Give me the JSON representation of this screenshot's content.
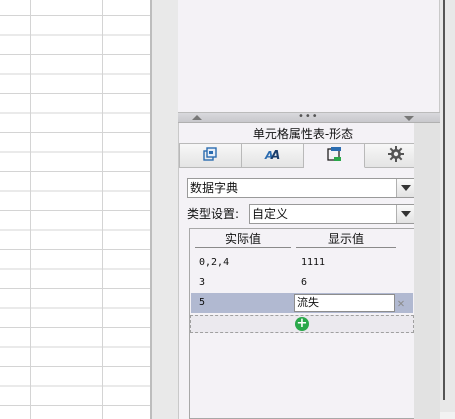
{
  "panel": {
    "title": "单元格属性表-形态"
  },
  "tabs": [
    {
      "icon": "cell-format-icon",
      "active": false
    },
    {
      "icon": "font-style-icon",
      "active": false
    },
    {
      "icon": "cell-element-icon",
      "active": true
    },
    {
      "icon": "gear-icon",
      "active": false
    }
  ],
  "form": {
    "dict_combo_value": "数据字典",
    "type_label": "类型设置:",
    "type_combo_value": "自定义"
  },
  "dict_table": {
    "headers": {
      "actual": "实际值",
      "display": "显示值"
    },
    "rows": [
      {
        "actual": "0,2,4",
        "display": "1111"
      },
      {
        "actual": "3",
        "display": "6"
      },
      {
        "actual": "5",
        "display": "流失",
        "selected": true
      }
    ],
    "delete_glyph": "✕",
    "add_glyph": "+"
  },
  "splitter": {
    "grip": "•••"
  },
  "colors": {
    "panel_bg": "#f4f2f6",
    "selected_row": "#b1b9d1",
    "add_icon": "#2aa84a",
    "active_tab_icon": "#2b6cb0"
  }
}
